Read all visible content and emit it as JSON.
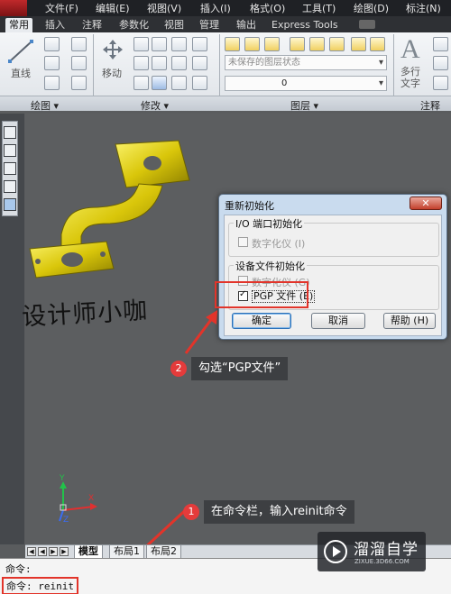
{
  "menu": {
    "items": [
      "文件(F)",
      "编辑(E)",
      "视图(V)",
      "插入(I)",
      "格式(O)",
      "工具(T)",
      "绘图(D)",
      "标注(N)"
    ]
  },
  "ribbon": {
    "tabs": [
      "常用",
      "插入",
      "注释",
      "参数化",
      "视图",
      "管理",
      "输出",
      "Express Tools"
    ],
    "line_tool_label": "直线",
    "move_tool_label": "移动",
    "multiline_text_label": "多行\n文字",
    "layer_state_combo": "未保存的图层状态",
    "layer_combo_value": "0",
    "panel_titles": [
      "绘图 ▾",
      "修改 ▾",
      "图层 ▾",
      "注释"
    ]
  },
  "canvas": {
    "watermark_text": "设计师小咖",
    "ucs_labels": [
      "Y",
      "Z",
      "X"
    ]
  },
  "dialog": {
    "title": "重新初始化",
    "close_label": "✕",
    "group1_label": "I/O 端口初始化",
    "group1_checkbox": "数字化仪 (I)",
    "group2_label": "设备文件初始化",
    "group2_checkbox1": "数字化仪 (G)",
    "group2_checkbox2": "PGP 文件 (E)",
    "ok_label": "确定",
    "cancel_label": "取消",
    "help_label": "帮助 (H)",
    "pgp_checked": true
  },
  "callouts": {
    "step1_number": "1",
    "step1_text": "在命令栏，输入reinit命令",
    "step2_number": "2",
    "step2_text": "勾选“PGP文件”"
  },
  "layout_tabs": [
    "模型",
    "布局1",
    "布局2"
  ],
  "command_line": {
    "line1": "命令:",
    "line2": "命令: reinit"
  },
  "brand": {
    "name": "溜溜自学",
    "url": "ZIXUE.3D66.COM"
  }
}
